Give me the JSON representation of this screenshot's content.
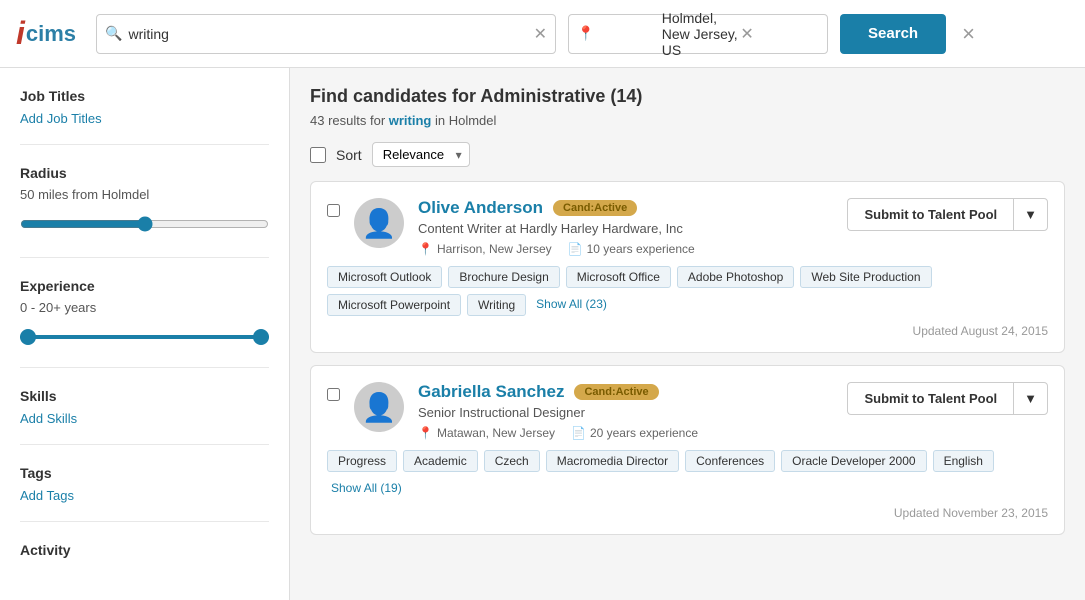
{
  "header": {
    "logo_i": "i",
    "logo_cims": "cims",
    "search_value": "writing",
    "location_value": "Holmdel, New Jersey, US",
    "search_button": "Search",
    "close_label": "×"
  },
  "sidebar": {
    "job_titles_label": "Job Titles",
    "add_job_titles": "Add Job Titles",
    "radius_label": "Radius",
    "radius_value": "50 miles from Holmdel",
    "experience_label": "Experience",
    "experience_value": "0 - 20+ years",
    "skills_label": "Skills",
    "add_skills": "Add Skills",
    "tags_label": "Tags",
    "add_tags": "Add Tags",
    "activity_label": "Activity"
  },
  "content": {
    "title": "Find candidates for Administrative (14)",
    "results_info_prefix": "43 results for ",
    "results_keyword": "writing",
    "results_info_suffix": " in Holmdel",
    "sort_label": "Sort",
    "sort_option": "Relevance",
    "candidates": [
      {
        "name": "Olive Anderson",
        "status": "Cand:Active",
        "title": "Content Writer at Hardly Harley Hardware, Inc",
        "location": "Harrison, New Jersey",
        "experience": "10 years experience",
        "submit_btn": "Submit to Talent Pool",
        "skills": [
          "Microsoft Outlook",
          "Brochure Design",
          "Microsoft Office",
          "Adobe Photoshop",
          "Web Site Production",
          "Microsoft Powerpoint",
          "Writing"
        ],
        "show_all": "Show All (23)",
        "updated": "Updated August 24, 2015"
      },
      {
        "name": "Gabriella Sanchez",
        "status": "Cand:Active",
        "title": "Senior Instructional Designer",
        "location": "Matawan, New Jersey",
        "experience": "20 years experience",
        "submit_btn": "Submit to Talent Pool",
        "skills": [
          "Progress",
          "Academic",
          "Czech",
          "Macromedia Director",
          "Conferences",
          "Oracle Developer 2000",
          "English"
        ],
        "show_all": "Show All (19)",
        "updated": "Updated November 23, 2015"
      }
    ]
  }
}
